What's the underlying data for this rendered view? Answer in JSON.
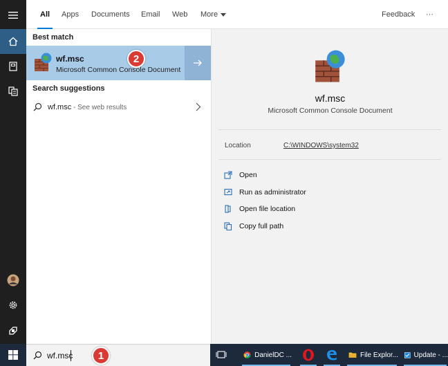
{
  "tabs": {
    "all": "All",
    "apps": "Apps",
    "documents": "Documents",
    "email": "Email",
    "web": "Web",
    "more": "More",
    "feedback": "Feedback",
    "overflow": "···"
  },
  "best_match": {
    "section_title": "Best match",
    "title": "wf.msc",
    "subtitle": "Microsoft Common Console Document"
  },
  "search_suggestions": {
    "section_title": "Search suggestions",
    "query": "wf.msc",
    "hint": " - See web results"
  },
  "details": {
    "app_name": "wf.msc",
    "app_type": "Microsoft Common Console Document",
    "location_label": "Location",
    "location_value": "C:\\WINDOWS\\system32",
    "actions": [
      {
        "label": "Open",
        "icon": "open-icon"
      },
      {
        "label": "Run as administrator",
        "icon": "shield-run-icon"
      },
      {
        "label": "Open file location",
        "icon": "folder-location-icon"
      },
      {
        "label": "Copy full path",
        "icon": "copy-icon"
      }
    ]
  },
  "taskbar": {
    "search_value": "wf.msc",
    "items": [
      {
        "label": "DanielDC ...",
        "icon": "chrome-icon"
      },
      {
        "label": "",
        "icon": "opera-icon"
      },
      {
        "label": "",
        "icon": "edge-icon"
      },
      {
        "label": "File Explor...",
        "icon": "file-explorer-icon"
      },
      {
        "label": "Update - ...",
        "icon": "checkbox-app-icon"
      }
    ]
  },
  "annotations": {
    "step1": "1",
    "step2": "2"
  },
  "colors": {
    "accent": "#0078d7",
    "selection": "#a8cbe8",
    "badge": "#d93a34",
    "taskbar": "#1c2a3c",
    "rail": "#1f1f1f"
  }
}
